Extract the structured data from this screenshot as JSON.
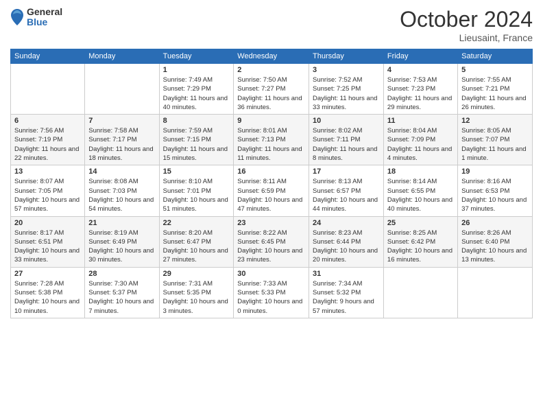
{
  "logo": {
    "general": "General",
    "blue": "Blue"
  },
  "header": {
    "month": "October 2024",
    "location": "Lieusaint, France"
  },
  "days_of_week": [
    "Sunday",
    "Monday",
    "Tuesday",
    "Wednesday",
    "Thursday",
    "Friday",
    "Saturday"
  ],
  "weeks": [
    [
      null,
      null,
      {
        "day": "1",
        "sunrise": "Sunrise: 7:49 AM",
        "sunset": "Sunset: 7:29 PM",
        "daylight": "Daylight: 11 hours and 40 minutes."
      },
      {
        "day": "2",
        "sunrise": "Sunrise: 7:50 AM",
        "sunset": "Sunset: 7:27 PM",
        "daylight": "Daylight: 11 hours and 36 minutes."
      },
      {
        "day": "3",
        "sunrise": "Sunrise: 7:52 AM",
        "sunset": "Sunset: 7:25 PM",
        "daylight": "Daylight: 11 hours and 33 minutes."
      },
      {
        "day": "4",
        "sunrise": "Sunrise: 7:53 AM",
        "sunset": "Sunset: 7:23 PM",
        "daylight": "Daylight: 11 hours and 29 minutes."
      },
      {
        "day": "5",
        "sunrise": "Sunrise: 7:55 AM",
        "sunset": "Sunset: 7:21 PM",
        "daylight": "Daylight: 11 hours and 26 minutes."
      }
    ],
    [
      {
        "day": "6",
        "sunrise": "Sunrise: 7:56 AM",
        "sunset": "Sunset: 7:19 PM",
        "daylight": "Daylight: 11 hours and 22 minutes."
      },
      {
        "day": "7",
        "sunrise": "Sunrise: 7:58 AM",
        "sunset": "Sunset: 7:17 PM",
        "daylight": "Daylight: 11 hours and 18 minutes."
      },
      {
        "day": "8",
        "sunrise": "Sunrise: 7:59 AM",
        "sunset": "Sunset: 7:15 PM",
        "daylight": "Daylight: 11 hours and 15 minutes."
      },
      {
        "day": "9",
        "sunrise": "Sunrise: 8:01 AM",
        "sunset": "Sunset: 7:13 PM",
        "daylight": "Daylight: 11 hours and 11 minutes."
      },
      {
        "day": "10",
        "sunrise": "Sunrise: 8:02 AM",
        "sunset": "Sunset: 7:11 PM",
        "daylight": "Daylight: 11 hours and 8 minutes."
      },
      {
        "day": "11",
        "sunrise": "Sunrise: 8:04 AM",
        "sunset": "Sunset: 7:09 PM",
        "daylight": "Daylight: 11 hours and 4 minutes."
      },
      {
        "day": "12",
        "sunrise": "Sunrise: 8:05 AM",
        "sunset": "Sunset: 7:07 PM",
        "daylight": "Daylight: 11 hours and 1 minute."
      }
    ],
    [
      {
        "day": "13",
        "sunrise": "Sunrise: 8:07 AM",
        "sunset": "Sunset: 7:05 PM",
        "daylight": "Daylight: 10 hours and 57 minutes."
      },
      {
        "day": "14",
        "sunrise": "Sunrise: 8:08 AM",
        "sunset": "Sunset: 7:03 PM",
        "daylight": "Daylight: 10 hours and 54 minutes."
      },
      {
        "day": "15",
        "sunrise": "Sunrise: 8:10 AM",
        "sunset": "Sunset: 7:01 PM",
        "daylight": "Daylight: 10 hours and 51 minutes."
      },
      {
        "day": "16",
        "sunrise": "Sunrise: 8:11 AM",
        "sunset": "Sunset: 6:59 PM",
        "daylight": "Daylight: 10 hours and 47 minutes."
      },
      {
        "day": "17",
        "sunrise": "Sunrise: 8:13 AM",
        "sunset": "Sunset: 6:57 PM",
        "daylight": "Daylight: 10 hours and 44 minutes."
      },
      {
        "day": "18",
        "sunrise": "Sunrise: 8:14 AM",
        "sunset": "Sunset: 6:55 PM",
        "daylight": "Daylight: 10 hours and 40 minutes."
      },
      {
        "day": "19",
        "sunrise": "Sunrise: 8:16 AM",
        "sunset": "Sunset: 6:53 PM",
        "daylight": "Daylight: 10 hours and 37 minutes."
      }
    ],
    [
      {
        "day": "20",
        "sunrise": "Sunrise: 8:17 AM",
        "sunset": "Sunset: 6:51 PM",
        "daylight": "Daylight: 10 hours and 33 minutes."
      },
      {
        "day": "21",
        "sunrise": "Sunrise: 8:19 AM",
        "sunset": "Sunset: 6:49 PM",
        "daylight": "Daylight: 10 hours and 30 minutes."
      },
      {
        "day": "22",
        "sunrise": "Sunrise: 8:20 AM",
        "sunset": "Sunset: 6:47 PM",
        "daylight": "Daylight: 10 hours and 27 minutes."
      },
      {
        "day": "23",
        "sunrise": "Sunrise: 8:22 AM",
        "sunset": "Sunset: 6:45 PM",
        "daylight": "Daylight: 10 hours and 23 minutes."
      },
      {
        "day": "24",
        "sunrise": "Sunrise: 8:23 AM",
        "sunset": "Sunset: 6:44 PM",
        "daylight": "Daylight: 10 hours and 20 minutes."
      },
      {
        "day": "25",
        "sunrise": "Sunrise: 8:25 AM",
        "sunset": "Sunset: 6:42 PM",
        "daylight": "Daylight: 10 hours and 16 minutes."
      },
      {
        "day": "26",
        "sunrise": "Sunrise: 8:26 AM",
        "sunset": "Sunset: 6:40 PM",
        "daylight": "Daylight: 10 hours and 13 minutes."
      }
    ],
    [
      {
        "day": "27",
        "sunrise": "Sunrise: 7:28 AM",
        "sunset": "Sunset: 5:38 PM",
        "daylight": "Daylight: 10 hours and 10 minutes."
      },
      {
        "day": "28",
        "sunrise": "Sunrise: 7:30 AM",
        "sunset": "Sunset: 5:37 PM",
        "daylight": "Daylight: 10 hours and 7 minutes."
      },
      {
        "day": "29",
        "sunrise": "Sunrise: 7:31 AM",
        "sunset": "Sunset: 5:35 PM",
        "daylight": "Daylight: 10 hours and 3 minutes."
      },
      {
        "day": "30",
        "sunrise": "Sunrise: 7:33 AM",
        "sunset": "Sunset: 5:33 PM",
        "daylight": "Daylight: 10 hours and 0 minutes."
      },
      {
        "day": "31",
        "sunrise": "Sunrise: 7:34 AM",
        "sunset": "Sunset: 5:32 PM",
        "daylight": "Daylight: 9 hours and 57 minutes."
      },
      null,
      null
    ]
  ]
}
